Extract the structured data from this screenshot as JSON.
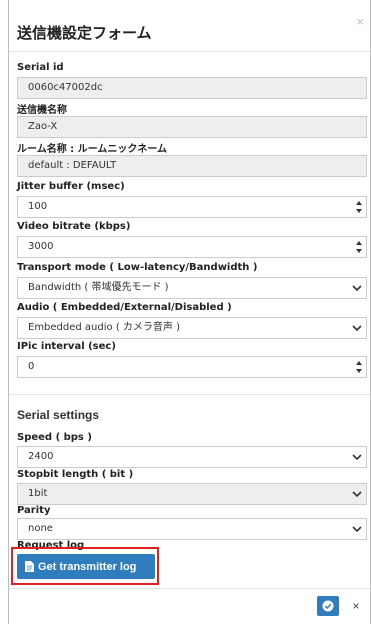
{
  "dialog": {
    "title": "送信機設定フォーム",
    "close_glyph": "×"
  },
  "fields": {
    "serial_id": {
      "label": "Serial id",
      "value": "0060c47002dc"
    },
    "transmitter_name": {
      "label": "送信機名称",
      "value": "Zao-X"
    },
    "room_name": {
      "label": "ルーム名称 : ルームニックネーム",
      "value": "default : DEFAULT"
    },
    "jitter_buffer": {
      "label": "Jitter buffer (msec)",
      "value": "100"
    },
    "video_bitrate": {
      "label": "Video bitrate (kbps)",
      "value": "3000"
    },
    "transport_mode": {
      "label": "Transport mode ( Low-latency/Bandwidth )",
      "value": "Bandwidth ( 帯域優先モード )"
    },
    "audio": {
      "label": "Audio ( Embedded/External/Disabled )",
      "value": "Embedded audio ( カメラ音声 )"
    },
    "ipic_interval": {
      "label": "IPic interval (sec)",
      "value": "0"
    }
  },
  "serial_settings": {
    "heading": "Serial settings",
    "speed": {
      "label": "Speed ( bps )",
      "value": "2400"
    },
    "stopbit": {
      "label": "Stopbit length ( bit )",
      "value": "1bit"
    },
    "parity": {
      "label": "Parity",
      "value": "none"
    }
  },
  "request_log": {
    "label": "Request log",
    "button_label": "Get transmitter log"
  },
  "footer": {
    "cancel_glyph": "×"
  },
  "colors": {
    "primary": "#2f7dbd",
    "highlight": "#e02020"
  }
}
